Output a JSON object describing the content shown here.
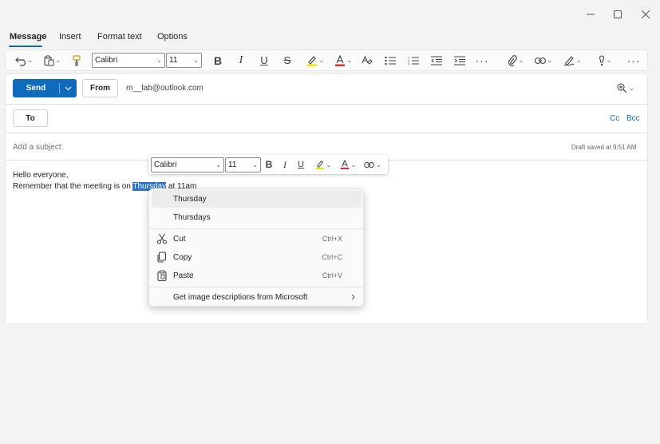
{
  "window": {
    "controls": [
      {
        "name": "minimize-button",
        "icon": "minimize-icon"
      },
      {
        "name": "maximize-button",
        "icon": "maximize-icon"
      },
      {
        "name": "close-button",
        "icon": "close-icon"
      }
    ]
  },
  "tabs": [
    {
      "label": "Message",
      "active": true
    },
    {
      "label": "Insert",
      "active": false
    },
    {
      "label": "Format text",
      "active": false
    },
    {
      "label": "Options",
      "active": false
    }
  ],
  "toolbar": {
    "font_name": "Calibri",
    "font_size": "11",
    "icons": [
      "undo-icon",
      "paste-icon",
      "format-painter-icon",
      "bold-icon",
      "italic-icon",
      "underline-icon",
      "strikethrough-icon",
      "highlight-icon",
      "font-color-icon",
      "clear-formatting-icon",
      "bullets-icon",
      "numbering-icon",
      "decrease-indent-icon",
      "increase-indent-icon",
      "more-icon",
      "attach-icon",
      "link-icon",
      "signature-icon",
      "importance-icon",
      "overflow-icon"
    ]
  },
  "compose": {
    "send_label": "Send",
    "from_label": "From",
    "from_address": "m__lab@outlook.com",
    "to_label": "To",
    "cc_label": "Cc",
    "bcc_label": "Bcc",
    "subject_placeholder": "Add a subject",
    "draft_status": "Draft saved at 9:51 AM",
    "body_line1": "Hello everyone,",
    "body_line2_before": "Remember that the meeting is on ",
    "body_selected": "Thursday",
    "body_line2_after": " at 11am"
  },
  "mini_toolbar": {
    "font_name": "Calibri",
    "font_size": "11"
  },
  "context_menu": {
    "suggestions": [
      "Thursday",
      "Thursdays"
    ],
    "cut": {
      "label": "Cut",
      "shortcut": "Ctrl+X"
    },
    "copy": {
      "label": "Copy",
      "shortcut": "Ctrl+C"
    },
    "paste": {
      "label": "Paste",
      "shortcut": "Ctrl+V"
    },
    "image_descriptions": "Get image descriptions from Microsoft"
  },
  "colors": {
    "accent": "#0f6cbd",
    "highlight": "#f2e600",
    "font_color": "#d13438",
    "selection": "#2d73c7"
  }
}
